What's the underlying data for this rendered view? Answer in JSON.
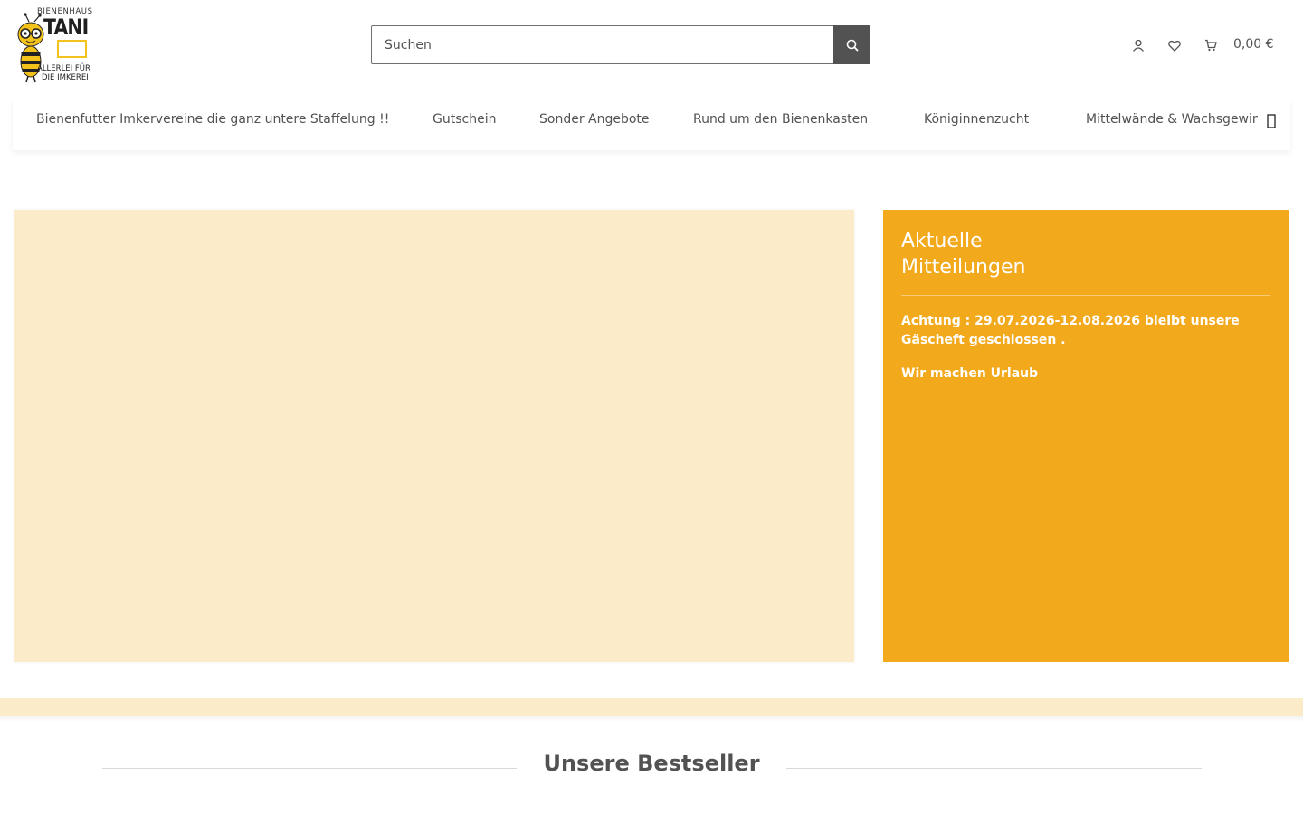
{
  "logo": {
    "top_text": "BIENENHAUS",
    "name": "TANI",
    "line1": "ALLERLEI FÜR",
    "line2": "DIE IMKEREI",
    "icon": "bee-mascot-icon"
  },
  "search": {
    "placeholder": "Suchen",
    "icon": "search-icon"
  },
  "header_icons": [
    "user-icon",
    "heart-icon",
    "cart-icon"
  ],
  "cart": {
    "total": "0,00 €"
  },
  "nav": {
    "items": [
      {
        "label": "Bienenfutter Imkervereine die ganz untere Staffelung !!",
        "dropdown": false
      },
      {
        "label": "Gutschein",
        "dropdown": false
      },
      {
        "label": "Sonder Angebote",
        "dropdown": false
      },
      {
        "label": "Rund um den Bienenkasten",
        "dropdown": true
      },
      {
        "label": "Königinnenzucht",
        "dropdown": true
      },
      {
        "label": "Mittelwände & Wachsgewin",
        "dropdown": false
      }
    ],
    "caret": "",
    "next_icon": "chevron-right-icon"
  },
  "news": {
    "title_line1": "Aktuelle",
    "title_line2": "Mitteilungen",
    "paragraph1": "Achtung : 29.07.2026-12.08.2026 bleibt unsere Gäscheft geschlossen .",
    "paragraph2": "Wir machen Urlaub"
  },
  "bestseller": {
    "title": "Unsere Bestseller"
  },
  "colors": {
    "accent": "#f3a91c",
    "hero_bg": "#fcebc9",
    "text": "#525252",
    "button": "#525252"
  }
}
